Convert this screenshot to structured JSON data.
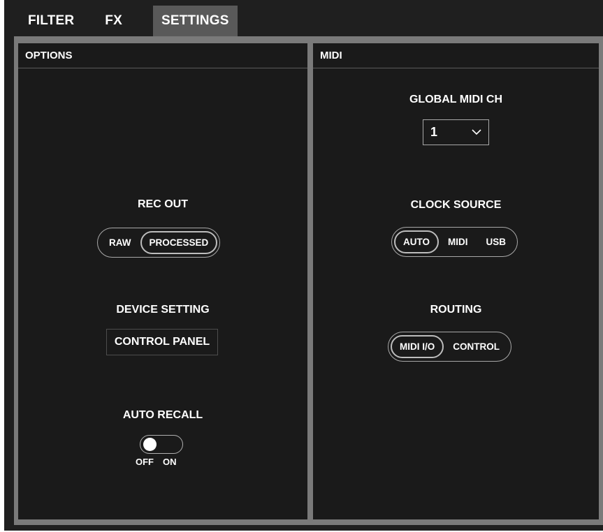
{
  "tabs": [
    {
      "label": "FILTER",
      "active": false
    },
    {
      "label": "FX",
      "active": false
    },
    {
      "label": "SETTINGS",
      "active": true
    }
  ],
  "options_panel": {
    "title": "OPTIONS",
    "rec_out": {
      "label": "REC OUT",
      "options": [
        "RAW",
        "PROCESSED"
      ],
      "selected": "PROCESSED"
    },
    "device_setting": {
      "label": "DEVICE SETTING",
      "button_label": "CONTROL PANEL"
    },
    "auto_recall": {
      "label": "AUTO RECALL",
      "off_label": "OFF",
      "on_label": "ON",
      "value": "OFF"
    }
  },
  "midi_panel": {
    "title": "MIDI",
    "global_midi_ch": {
      "label": "GLOBAL MIDI CH",
      "value": "1"
    },
    "clock_source": {
      "label": "CLOCK SOURCE",
      "options": [
        "AUTO",
        "MIDI",
        "USB"
      ],
      "selected": "AUTO"
    },
    "routing": {
      "label": "ROUTING",
      "options": [
        "MIDI I/O",
        "CONTROL"
      ],
      "selected": "MIDI I/O"
    }
  },
  "colors": {
    "background": "#1f1f1f",
    "panel": "#1a1a1a",
    "frame": "#7a7a7a",
    "active_tab": "#595959",
    "text": "#ffffff"
  }
}
